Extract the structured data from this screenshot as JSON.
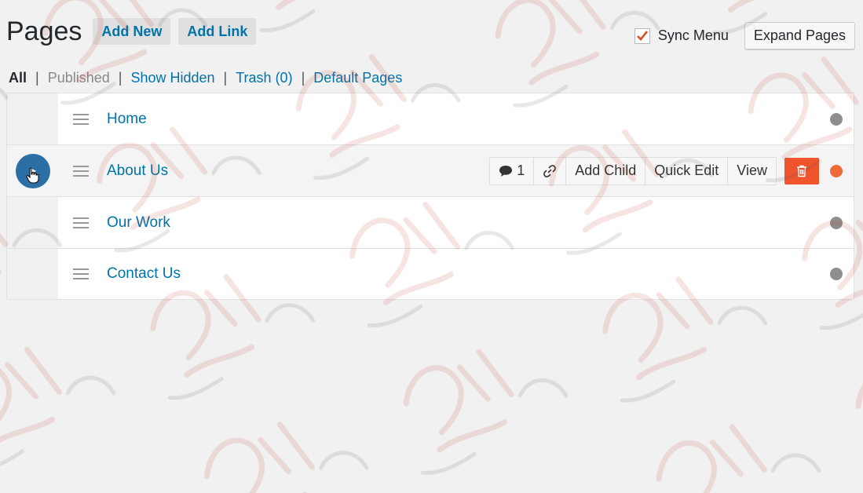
{
  "header": {
    "title": "Pages",
    "add_new_label": "Add New",
    "add_link_label": "Add Link",
    "sync_menu_label": "Sync Menu",
    "sync_menu_checked": true,
    "expand_pages_label": "Expand Pages"
  },
  "filters": {
    "all": "All",
    "published": "Published",
    "show_hidden": "Show Hidden",
    "trash": "Trash (0)",
    "default_pages": "Default Pages",
    "separator": "|"
  },
  "rows": [
    {
      "label": "Home",
      "status_color": "#8e8e8e"
    },
    {
      "label": "About Us",
      "status_color": "#f06b3a",
      "comment_count": "1",
      "actions": {
        "add_child": "Add Child",
        "quick_edit": "Quick Edit",
        "view": "View"
      }
    },
    {
      "label": "Our Work",
      "status_color": "#8e8e8e"
    },
    {
      "label": "Contact Us",
      "status_color": "#8e8e8e"
    }
  ],
  "colors": {
    "accent": "#0073aa",
    "toggle": "#2b6fa6",
    "trash": "#f0542d",
    "checkmark": "#d54e21"
  },
  "icons": [
    "menu-handle-icon",
    "play-icon",
    "cursor-hand-icon",
    "comment-icon",
    "link-icon",
    "trash-icon",
    "checkmark-icon"
  ]
}
